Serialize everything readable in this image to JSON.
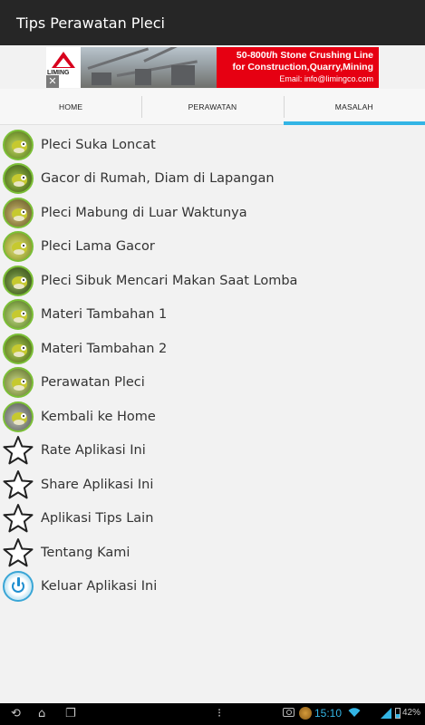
{
  "app": {
    "title": "Tips Perawatan Pleci"
  },
  "ad": {
    "brand": "LIMING",
    "close_label": "✕",
    "line1": "50-800t/h Stone Crushing Line",
    "line2": "for Construction,Quarry,Mining",
    "line3": "Email: info@limingco.com"
  },
  "tabs": [
    {
      "label": "HOME",
      "active": false
    },
    {
      "label": "PERAWATAN",
      "active": false
    },
    {
      "label": "MASALAH",
      "active": true
    }
  ],
  "menu": [
    {
      "label": "Pleci Suka Loncat",
      "icon": "bird-icon"
    },
    {
      "label": "Gacor di Rumah, Diam di Lapangan",
      "icon": "bird-icon"
    },
    {
      "label": "Pleci Mabung di Luar Waktunya",
      "icon": "bird-icon"
    },
    {
      "label": "Pleci Lama Gacor",
      "icon": "bird-icon"
    },
    {
      "label": "Pleci Sibuk Mencari Makan Saat Lomba",
      "icon": "bird-icon"
    },
    {
      "label": "Materi Tambahan 1",
      "icon": "bird-icon"
    },
    {
      "label": "Materi Tambahan 2",
      "icon": "bird-icon"
    },
    {
      "label": "Perawatan Pleci",
      "icon": "bird-icon"
    },
    {
      "label": "Kembali ke Home",
      "icon": "bird-icon"
    },
    {
      "label": "Rate Aplikasi Ini",
      "icon": "star-icon"
    },
    {
      "label": "Share Aplikasi Ini",
      "icon": "star-icon"
    },
    {
      "label": "Aplikasi Tips Lain",
      "icon": "star-icon"
    },
    {
      "label": "Tentang Kami",
      "icon": "star-icon"
    },
    {
      "label": "Keluar Aplikasi Ini",
      "icon": "power-icon"
    }
  ],
  "statusbar": {
    "time": "15:10",
    "battery": "42%"
  },
  "colors": {
    "accent": "#33b5e5",
    "titlebar": "#262626",
    "ad_red": "#e60012"
  }
}
